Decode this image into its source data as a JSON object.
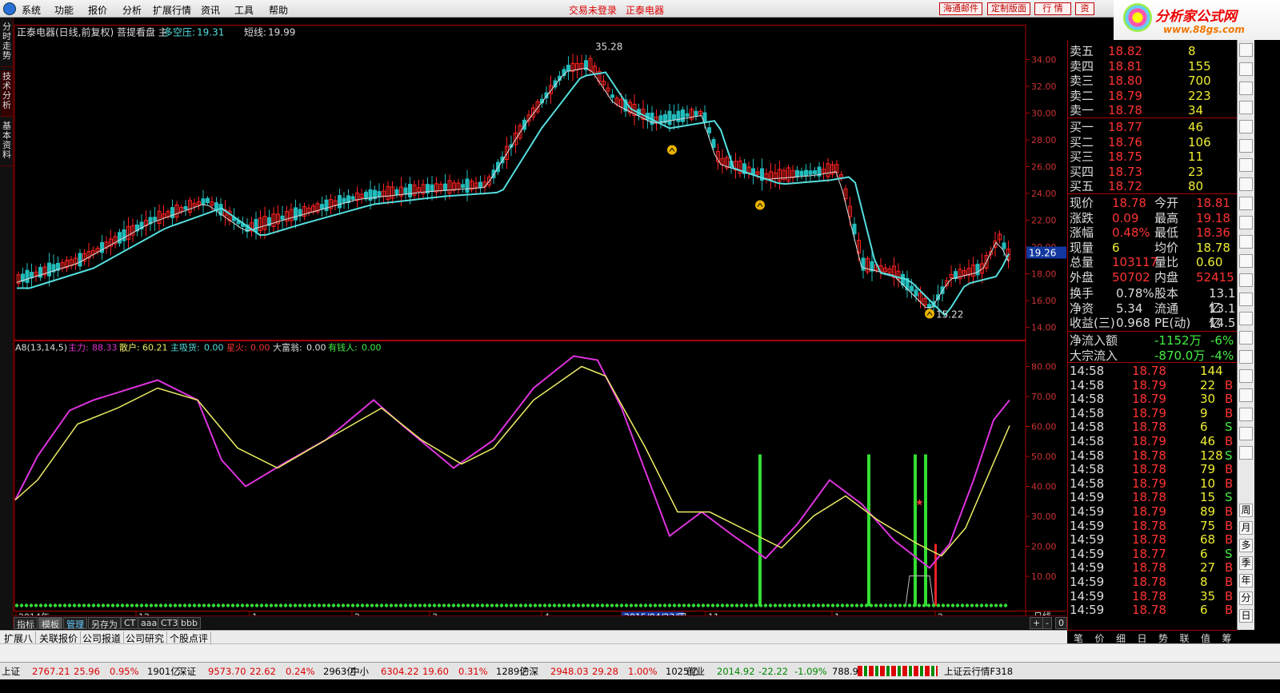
{
  "menubar": {
    "items": [
      "系统",
      "功能",
      "报价",
      "分析",
      "扩展行情",
      "资讯",
      "工具",
      "帮助"
    ],
    "login": "交易未登录",
    "stock": "正泰电器",
    "buttons": [
      "海通邮件",
      "定制版面",
      "行 情",
      "资"
    ]
  },
  "brand": {
    "name": "分析家公式网",
    "url": "www.88gs.com"
  },
  "lefttabs": [
    "分时走势",
    "技术分析",
    "基本资料"
  ],
  "main_header": {
    "title": "正泰电器(日线,前复权) 菩提看盘 主",
    "label1": "多空压:",
    "value1": "19.31",
    "label2": "短线:",
    "value2": "19.99"
  },
  "main_ticks": [
    "34.00",
    "32.00",
    "30.00",
    "28.00",
    "26.00",
    "24.00",
    "22.00",
    "20.00",
    "18.00",
    "16.00",
    "14.00"
  ],
  "price_badge": "19.26",
  "high_label": "35.28",
  "low_label": "15.22",
  "ind_header": {
    "name": "A8(13,14,5)",
    "l1": "主力:",
    "v1": "88.33",
    "l2": "散户:",
    "v2": "60.21",
    "l3": "主吸货:",
    "v3": "0.00",
    "l4": "星火:",
    "v4": "0.00",
    "l5": "大富翁:",
    "v5": "0.00",
    "l6": "有钱人:",
    "v6": "0.00"
  },
  "ind_ticks": [
    "80.00",
    "70.00",
    "60.00",
    "50.00",
    "40.00",
    "30.00",
    "20.00",
    "10.00"
  ],
  "xaxis": {
    "labels": [
      "2014年",
      "12",
      "1",
      "2",
      "3",
      "4",
      "2015/04/23/四",
      "11",
      "1",
      "2"
    ],
    "period": "日线"
  },
  "subtabs": [
    "指标",
    "模板",
    "管理",
    "另存为",
    "CT",
    "aaa",
    "CT3",
    "bbb"
  ],
  "zoom": [
    "+",
    "-",
    "0"
  ],
  "bottabs": [
    "扩展八",
    "关联报价",
    "公司报道",
    "公司研究",
    "个股点评"
  ],
  "quote": {
    "ask": [
      [
        "卖五",
        "18.82",
        "8"
      ],
      [
        "卖四",
        "18.81",
        "155"
      ],
      [
        "卖三",
        "18.80",
        "700"
      ],
      [
        "卖二",
        "18.79",
        "223"
      ],
      [
        "卖一",
        "18.78",
        "34"
      ]
    ],
    "bid": [
      [
        "买一",
        "18.77",
        "46"
      ],
      [
        "买二",
        "18.76",
        "106"
      ],
      [
        "买三",
        "18.75",
        "11"
      ],
      [
        "买四",
        "18.73",
        "23"
      ],
      [
        "买五",
        "18.72",
        "80"
      ]
    ],
    "stats": [
      [
        "现价",
        "18.78",
        "今开",
        "18.81"
      ],
      [
        "涨跌",
        "0.09",
        "最高",
        "19.18"
      ],
      [
        "涨幅",
        "0.48%",
        "最低",
        "18.36"
      ],
      [
        "现量",
        "6",
        "均价",
        "18.78"
      ],
      [
        "总量",
        "103117",
        "量比",
        "0.60"
      ],
      [
        "外盘",
        "50702",
        "内盘",
        "52415"
      ]
    ],
    "info": [
      [
        "换手",
        "0.78%",
        "股本",
        "13.1亿"
      ],
      [
        "净资",
        "5.34",
        "流通",
        "13.1亿"
      ],
      [
        "收益(三)",
        "0.968",
        "PE(动)",
        "14.5"
      ]
    ],
    "flow": [
      [
        "净流入额",
        "-1152万",
        "-6%"
      ],
      [
        "大宗流入",
        "-870.0万",
        "-4%"
      ]
    ],
    "ticks": [
      [
        "14:58",
        "18.78",
        "144",
        ""
      ],
      [
        "14:58",
        "18.79",
        "22",
        "B"
      ],
      [
        "14:58",
        "18.79",
        "30",
        "B"
      ],
      [
        "14:58",
        "18.79",
        "9",
        "B"
      ],
      [
        "14:58",
        "18.78",
        "6",
        "S"
      ],
      [
        "14:58",
        "18.79",
        "46",
        "B"
      ],
      [
        "14:58",
        "18.78",
        "128",
        "S"
      ],
      [
        "14:58",
        "18.78",
        "79",
        "B"
      ],
      [
        "14:58",
        "18.79",
        "10",
        "B"
      ],
      [
        "14:59",
        "18.78",
        "15",
        "S"
      ],
      [
        "14:59",
        "18.79",
        "89",
        "B"
      ],
      [
        "14:59",
        "18.78",
        "75",
        "B"
      ],
      [
        "14:59",
        "18.78",
        "68",
        "B"
      ],
      [
        "14:59",
        "18.77",
        "6",
        "S"
      ],
      [
        "14:59",
        "18.78",
        "27",
        "B"
      ],
      [
        "14:59",
        "18.78",
        "8",
        "B"
      ],
      [
        "14:59",
        "18.78",
        "35",
        "B"
      ],
      [
        "14:59",
        "18.78",
        "6",
        "B"
      ]
    ]
  },
  "qtabs": [
    "笔",
    "价",
    "细",
    "日",
    "势",
    "联",
    "值",
    "筹"
  ],
  "rtools": [
    "周",
    "月",
    "多",
    "季",
    "年",
    "分",
    "日"
  ],
  "status": [
    {
      "name": "上证",
      "value": "2767.21",
      "chg": "25.96",
      "pct": "0.95%",
      "amt": "1901亿"
    },
    {
      "name": "深证",
      "value": "9573.70",
      "chg": "22.62",
      "pct": "0.24%",
      "amt": "2963亿"
    },
    {
      "name": "中小",
      "value": "6304.22",
      "chg": "19.60",
      "pct": "0.31%",
      "amt": "1289亿"
    },
    {
      "name": "沪深",
      "value": "2948.03",
      "chg": "29.28",
      "pct": "1.00%",
      "amt": "1025亿"
    },
    {
      "name": "创业",
      "value": "2014.92",
      "chg": "-22.22",
      "pct": "-1.09%",
      "amt": "788.9亿"
    }
  ],
  "status_right": "上证云行情F318"
}
